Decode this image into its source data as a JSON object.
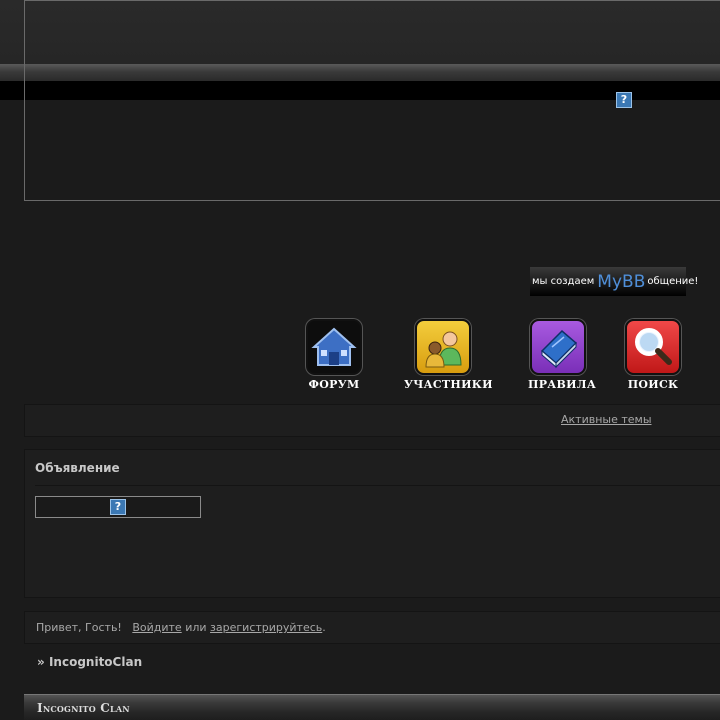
{
  "banner": {
    "broken_image_glyph": "?",
    "mybb_prefix": "мы создаем",
    "mybb_brand": "MyBB",
    "mybb_suffix": "общение!"
  },
  "nav": {
    "items": [
      {
        "label": "ФОРУМ",
        "icon": "home-icon",
        "color": "#3d6fc4"
      },
      {
        "label": "УЧАСТНИКИ",
        "icon": "users-icon",
        "color": "#e6b21a"
      },
      {
        "label": "ПРАВИЛА",
        "icon": "book-icon",
        "color": "#8a3cc8"
      },
      {
        "label": "ПОИСК",
        "icon": "search-icon",
        "color": "#d83030"
      }
    ]
  },
  "links": {
    "active_topics": "Активные темы"
  },
  "announcement": {
    "title": "Объявление",
    "broken_image_glyph": "?"
  },
  "guest": {
    "greeting": "Привет, Гость!",
    "login": "Войдите",
    "or": "или",
    "register": "зарегистрируйтесь",
    "period": "."
  },
  "breadcrumb": {
    "prefix": "»",
    "forum_name": "IncognitoClan"
  },
  "category": {
    "title": "Incognito Clan"
  }
}
